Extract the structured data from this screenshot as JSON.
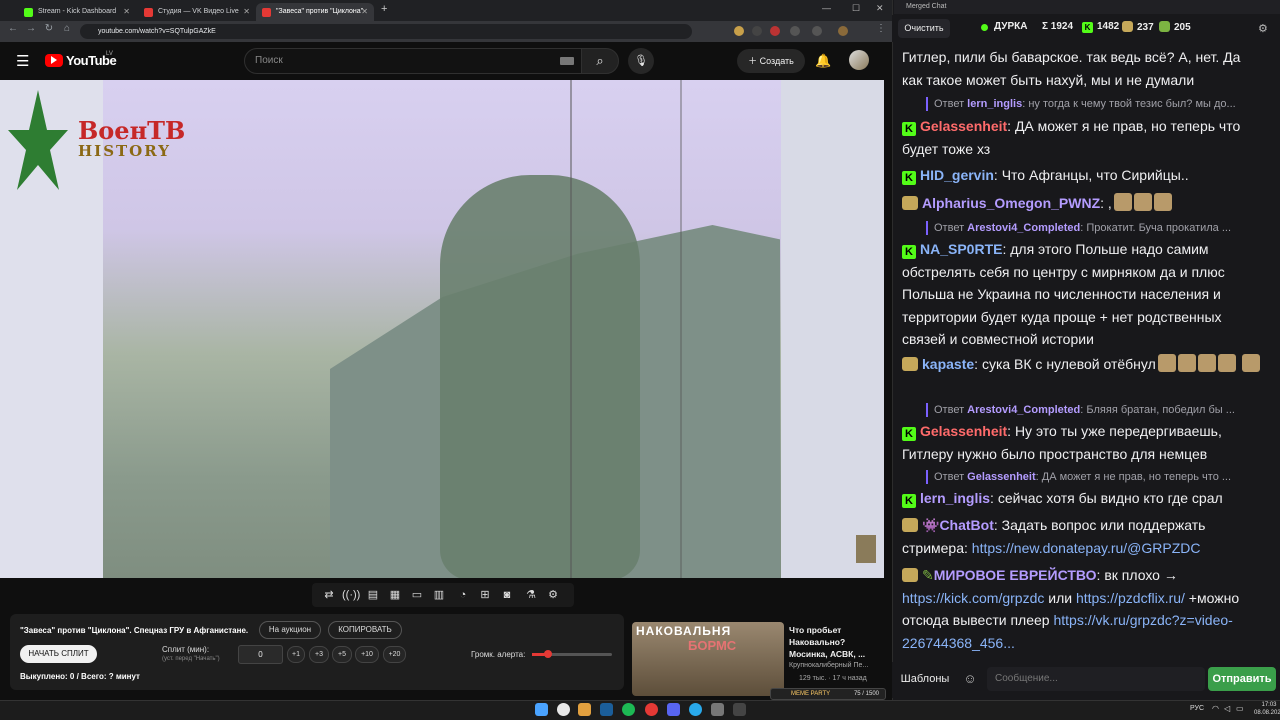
{
  "browser": {
    "tabs": [
      {
        "label": "Stream - Kick Dashboard",
        "color": "#53fc18"
      },
      {
        "label": "Студия — VK Видео Live",
        "color": "#e53935"
      },
      {
        "label": "\"Завеса\" против \"Циклона\"",
        "color": "#e53935"
      }
    ],
    "url": "youtube.com/watch?v=SQTulpGAZkE"
  },
  "youtube": {
    "logo": "YouTube",
    "region": "LV",
    "search_placeholder": "Поиск",
    "create_label": "Создать"
  },
  "video": {
    "channel_logo": "ВоенТВ",
    "channel_logo_sub": "HISTORY"
  },
  "panel": {
    "title": "\"Завеса\" против \"Циклона\". Спецназ ГРУ в Афганистане.",
    "auction_label": "На аукцион",
    "copy_label": "КОПИРОВАТЬ",
    "start_split_label": "НАЧАТЬ СПЛИТ",
    "split_label": "Сплит (мин):",
    "split_hint": "(уст. перед \"Начать\")",
    "split_value": "0",
    "increments": [
      "+1",
      "+3",
      "+5",
      "+10",
      "+20"
    ],
    "alert_volume_label": "Громк. алерта:",
    "alert_volume": 0.2,
    "bought_text": "Выкуплено: 0 / Всего: ? минут"
  },
  "recommendation": {
    "thumb_text_1": "НАКОВАЛЬНЯ",
    "thumb_text_2": "БОРМС",
    "title": "Что пробьет Наковально? Мосинка, АСВК, ...",
    "channel": "Крупнокалиберный Пе...",
    "meta": "129 тыс. · 17 ч назад",
    "meme_label": "MEME PARTY",
    "meme_progress": "75 / 1500"
  },
  "chat": {
    "window_title": "Merged Chat",
    "clear_label": "Очистить",
    "stats": {
      "name": "ДУРКА",
      "total": "Σ 1924",
      "kick": "1482",
      "vk": "237",
      "other": "205"
    },
    "top_partial": "Гитлер, пили бы баварское. так ведь всё? А, нет. Да как такое может быть нахуй, мы и не думали",
    "messages": [
      {
        "reply_user": "lern_inglis",
        "reply_text": "ну тогда к чему твой тезис был? мы до..."
      },
      {
        "user": "Gelassenheit",
        "text": "ДА может я не прав, но теперь что будет тоже хз",
        "color": "#ff6b6b"
      },
      {
        "user": "HID_gervin",
        "text": "Что Афганцы, что Сирийцы..",
        "color": "#8ab4f8"
      },
      {
        "user": "Alpharius_Omegon_PWNZ",
        "text": ",",
        "color": "#b49cff"
      },
      {
        "reply_user": "Arestovi4_Completed",
        "reply_text": "Прокатит. Буча прокатила ..."
      },
      {
        "user": "NA_SP0RTE",
        "text": "для этого Польше надо самим обстрелять себя по центру с мирняком да и плюс Польша не Украина по численности населения и территории будет куда проще + нет родственных связей и совместной истории",
        "color": "#8ab4f8"
      },
      {
        "user": "kapaste",
        "text": "сука ВК с нулевой отёбнул",
        "color": "#8ab4f8"
      },
      {
        "reply_user": "Arestovi4_Completed",
        "reply_text": "Бляяя братан, победил бы ..."
      },
      {
        "user": "Gelassenheit",
        "text": "Ну это ты уже передергиваешь, Гитлеру нужно было пространство для немцев",
        "color": "#ff6b6b"
      },
      {
        "reply_user": "Gelassenheit",
        "reply_text": "ДА может я не прав, но теперь что ..."
      },
      {
        "user": "lern_inglis",
        "text": "сейчас хотя бы видно кто где срал",
        "color": "#b49cff"
      },
      {
        "user": "ChatBot",
        "text": "Задать вопрос или поддержать стримера: ",
        "link": "https://new.donatepay.ru/@GRPZDC",
        "color": "#b49cff"
      },
      {
        "user": "МИРОВОЕ ЕВРЕЙСТВО",
        "text": "вк плохо → ",
        "link": "https://kick.com/grpzdc",
        "mid": " или ",
        "link2": "https://pzdcflix.ru/",
        "text2": " +можно отсюда вывести плеер ",
        "link3": "https://vk.ru/grpzdc?z=video-226744368_456...",
        "color": "#b49cff"
      }
    ],
    "templates_label": "Шаблоны",
    "input_placeholder": "Сообщение...",
    "send_label": "Отправить"
  },
  "taskbar": {
    "lang": "РУС",
    "time": "17:03",
    "date": "08.08.2026"
  }
}
